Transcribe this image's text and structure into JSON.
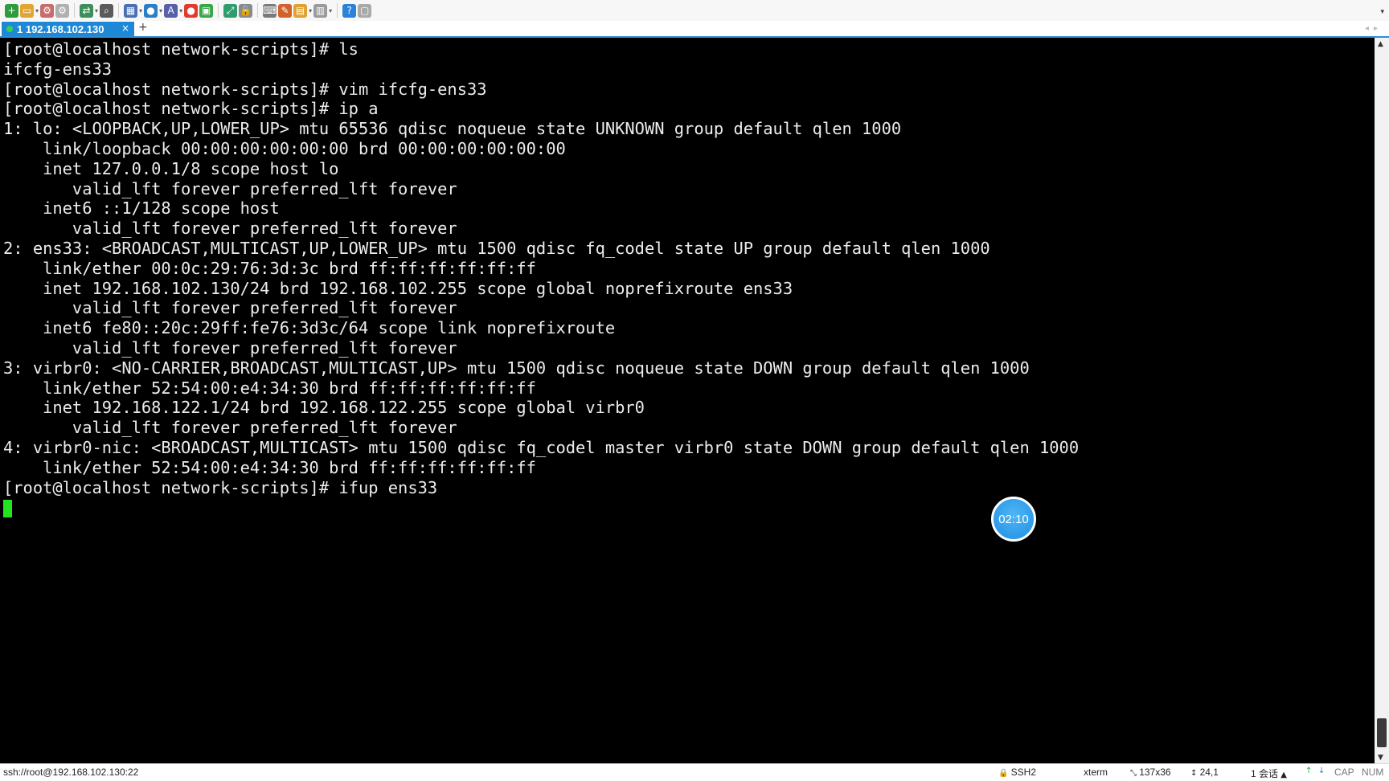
{
  "toolbar": {
    "icons": [
      {
        "name": "new-session-icon",
        "glyph": "+",
        "color": "#2f9a3e"
      },
      {
        "name": "open-folder-icon",
        "glyph": "▭",
        "color": "#e3a531"
      },
      {
        "name": "connect-icon",
        "glyph": "⚙",
        "color": "#c76b6b"
      },
      {
        "name": "disconnect-icon",
        "glyph": "⚙",
        "color": "#b0b0b0"
      },
      {
        "name": "transfer-icon",
        "glyph": "⇄",
        "color": "#3c8f5a"
      },
      {
        "name": "find-icon",
        "glyph": "⌕",
        "color": "#5a5a5a"
      },
      {
        "name": "layout-icon",
        "glyph": "▦",
        "color": "#4a6fb5"
      },
      {
        "name": "globe-icon",
        "glyph": "●",
        "color": "#2b7fc8"
      },
      {
        "name": "font-icon",
        "glyph": "A",
        "color": "#5560a8"
      },
      {
        "name": "record-icon",
        "glyph": "●",
        "color": "#e23b2e"
      },
      {
        "name": "script-icon",
        "glyph": "▣",
        "color": "#3aa64a"
      },
      {
        "name": "fullscreen-icon",
        "glyph": "⤢",
        "color": "#2e9c6d"
      },
      {
        "name": "lock-icon",
        "glyph": "🔒",
        "color": "#8a8a8a"
      },
      {
        "name": "keyboard-icon",
        "glyph": "⌨",
        "color": "#7a7a7a"
      },
      {
        "name": "highlight-icon",
        "glyph": "✎",
        "color": "#d2622a"
      },
      {
        "name": "file-transfer-icon",
        "glyph": "▤",
        "color": "#e0a030"
      },
      {
        "name": "view-icon",
        "glyph": "▥",
        "color": "#9a9a9a"
      },
      {
        "name": "help-icon",
        "glyph": "?",
        "color": "#2b82d6"
      },
      {
        "name": "chat-icon",
        "glyph": "▢",
        "color": "#a9a9a9"
      }
    ]
  },
  "tab": {
    "label": "1 192.168.102.130",
    "close": "×",
    "add": "+"
  },
  "terminal": {
    "lines": [
      "[root@localhost network-scripts]# ls",
      "ifcfg-ens33",
      "[root@localhost network-scripts]# vim ifcfg-ens33",
      "[root@localhost network-scripts]# ip a",
      "1: lo: <LOOPBACK,UP,LOWER_UP> mtu 65536 qdisc noqueue state UNKNOWN group default qlen 1000",
      "    link/loopback 00:00:00:00:00:00 brd 00:00:00:00:00:00",
      "    inet 127.0.0.1/8 scope host lo",
      "       valid_lft forever preferred_lft forever",
      "    inet6 ::1/128 scope host",
      "       valid_lft forever preferred_lft forever",
      "2: ens33: <BROADCAST,MULTICAST,UP,LOWER_UP> mtu 1500 qdisc fq_codel state UP group default qlen 1000",
      "    link/ether 00:0c:29:76:3d:3c brd ff:ff:ff:ff:ff:ff",
      "    inet 192.168.102.130/24 brd 192.168.102.255 scope global noprefixroute ens33",
      "       valid_lft forever preferred_lft forever",
      "    inet6 fe80::20c:29ff:fe76:3d3c/64 scope link noprefixroute",
      "       valid_lft forever preferred_lft forever",
      "3: virbr0: <NO-CARRIER,BROADCAST,MULTICAST,UP> mtu 1500 qdisc noqueue state DOWN group default qlen 1000",
      "    link/ether 52:54:00:e4:34:30 brd ff:ff:ff:ff:ff:ff",
      "    inet 192.168.122.1/24 brd 192.168.122.255 scope global virbr0",
      "       valid_lft forever preferred_lft forever",
      "4: virbr0-nic: <BROADCAST,MULTICAST> mtu 1500 qdisc fq_codel master virbr0 state DOWN group default qlen 1000",
      "    link/ether 52:54:00:e4:34:30 brd ff:ff:ff:ff:ff:ff",
      "[root@localhost network-scripts]# ifup ens33"
    ],
    "cursor_color": "#22e51f",
    "background": "#000000",
    "foreground": "#ececec"
  },
  "timer_badge": {
    "text": "02:10"
  },
  "status_bar": {
    "connection": "ssh://root@192.168.102.130:22",
    "protocol": "SSH2",
    "terminal_type": "xterm",
    "size": "137x36",
    "cursor_pos": "24,1",
    "sessions": "1 会话",
    "cap": "CAP",
    "num": "NUM"
  },
  "colors": {
    "tab_active": "#1e88d6",
    "tab_underline": "#2d8fd5",
    "status_ok": "#34d34a"
  }
}
